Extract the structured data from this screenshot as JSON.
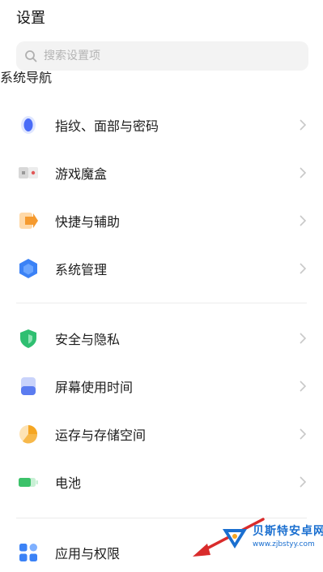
{
  "header": {
    "title": "设置"
  },
  "search": {
    "placeholder": "搜索设置项",
    "icon": "search-icon"
  },
  "partial_item": {
    "label": "系统导航",
    "icon": "navigation-icon"
  },
  "group1": [
    {
      "label": "指纹、面部与密码",
      "icon": "fingerprint-icon",
      "color": "#4a6cf7"
    },
    {
      "label": "游戏魔盒",
      "icon": "game-box-icon",
      "color": "#e25858"
    },
    {
      "label": "快捷与辅助",
      "icon": "shortcut-icon",
      "color": "#f59a2e"
    },
    {
      "label": "系统管理",
      "icon": "system-manage-icon",
      "color": "#3b82f6"
    }
  ],
  "group2": [
    {
      "label": "安全与隐私",
      "icon": "shield-icon",
      "color": "#2fbf71"
    },
    {
      "label": "屏幕使用时间",
      "icon": "screen-time-icon",
      "color": "#5b7cf0"
    },
    {
      "label": "运存与存储空间",
      "icon": "storage-icon",
      "color": "#f5a623"
    },
    {
      "label": "电池",
      "icon": "battery-icon",
      "color": "#3cc26a"
    }
  ],
  "group3": [
    {
      "label": "应用与权限",
      "icon": "apps-icon",
      "color": "#3b82f6"
    }
  ],
  "watermark": {
    "name": "贝斯特安卓网",
    "url": "www.zjbstyy.com"
  }
}
